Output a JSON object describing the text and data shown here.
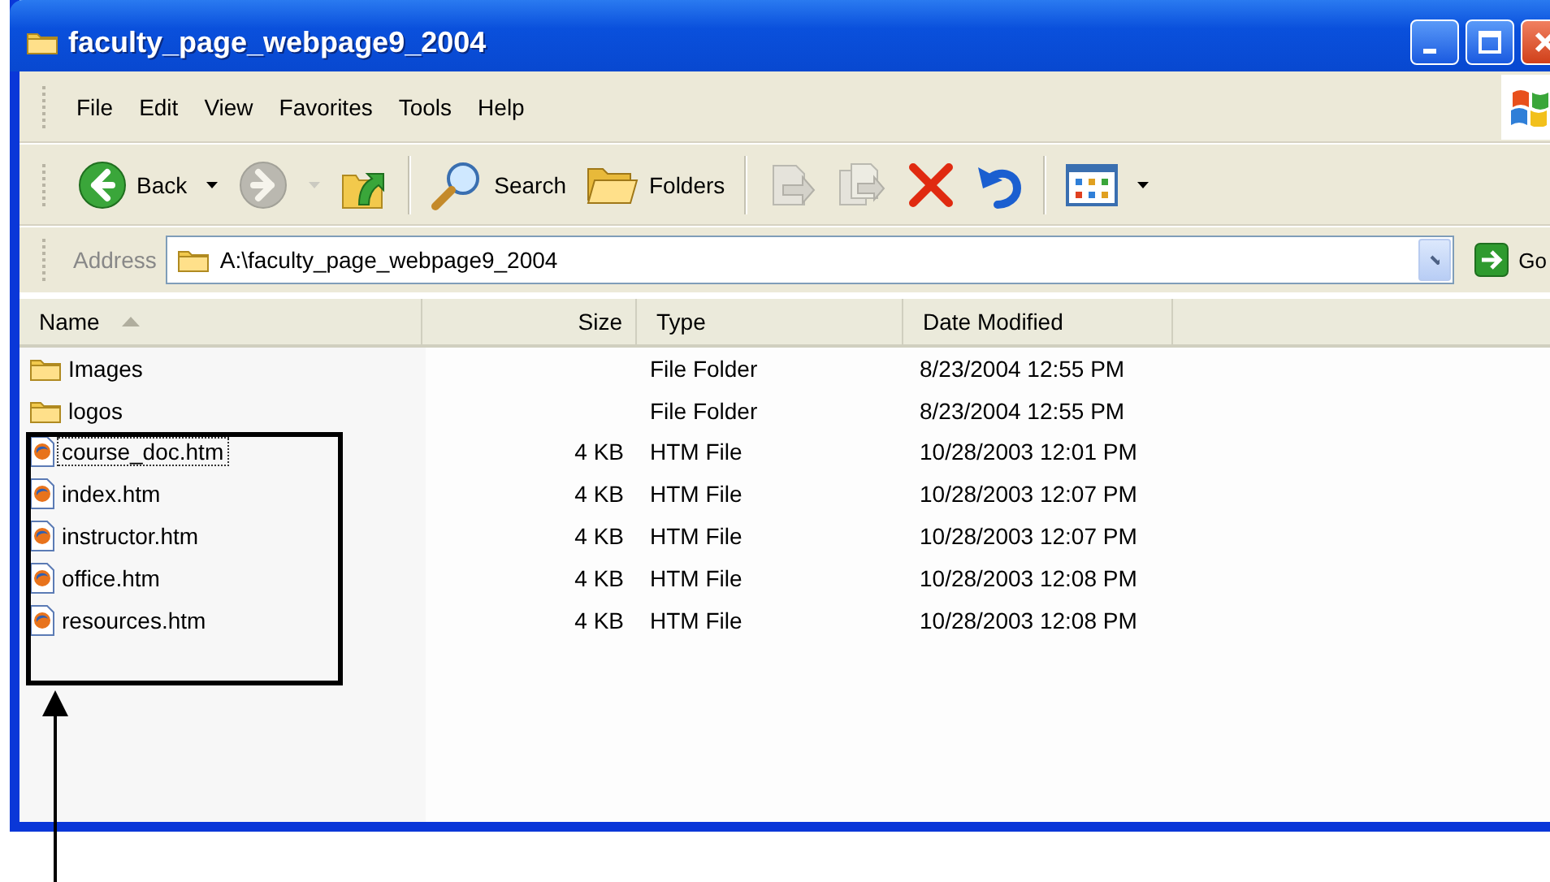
{
  "window": {
    "title": "faculty_page_webpage9_2004"
  },
  "menu": [
    "File",
    "Edit",
    "View",
    "Favorites",
    "Tools",
    "Help"
  ],
  "toolbar": [
    {
      "kind": "back",
      "label": "Back",
      "disabled": false,
      "dropdown": true
    },
    {
      "kind": "forward",
      "disabled": true,
      "dropdown": true
    },
    {
      "kind": "up",
      "disabled": false
    },
    {
      "kind": "separator"
    },
    {
      "kind": "search",
      "label": "Search",
      "disabled": false
    },
    {
      "kind": "folders",
      "label": "Folders",
      "disabled": false
    },
    {
      "kind": "separator"
    },
    {
      "kind": "move",
      "disabled": true
    },
    {
      "kind": "copy",
      "disabled": true
    },
    {
      "kind": "delete",
      "disabled": false
    },
    {
      "kind": "undo",
      "disabled": false
    },
    {
      "kind": "separator"
    },
    {
      "kind": "views",
      "disabled": false,
      "dropdown": true
    }
  ],
  "address": {
    "label": "Address",
    "value": "A:\\faculty_page_webpage9_2004",
    "go": "Go"
  },
  "columns": [
    {
      "label": "Name",
      "sorted": true
    },
    {
      "label": "Size",
      "sorted": false
    },
    {
      "label": "Type",
      "sorted": false
    },
    {
      "label": "Date Modified",
      "sorted": false
    }
  ],
  "files": [
    {
      "kind": "folder",
      "name": "Images",
      "type": "File Folder",
      "date": "8/23/2004 12:55 PM",
      "focused": false
    },
    {
      "kind": "folder",
      "name": "logos",
      "type": "File Folder",
      "date": "8/23/2004 12:55 PM",
      "focused": false
    },
    {
      "kind": "htm",
      "name": "course_doc.htm",
      "size": "4 KB",
      "type": "HTM File",
      "date": "10/28/2003 12:01 PM",
      "focused": true
    },
    {
      "kind": "htm",
      "name": "index.htm",
      "size": "4 KB",
      "type": "HTM File",
      "date": "10/28/2003 12:07 PM",
      "focused": false
    },
    {
      "kind": "htm",
      "name": "instructor.htm",
      "size": "4 KB",
      "type": "HTM File",
      "date": "10/28/2003 12:07 PM",
      "focused": false
    },
    {
      "kind": "htm",
      "name": "office.htm",
      "size": "4 KB",
      "type": "HTM File",
      "date": "10/28/2003 12:08 PM",
      "focused": false
    },
    {
      "kind": "htm",
      "name": "resources.htm",
      "size": "4 KB",
      "type": "HTM File",
      "date": "10/28/2003 12:08 PM",
      "focused": false
    }
  ]
}
